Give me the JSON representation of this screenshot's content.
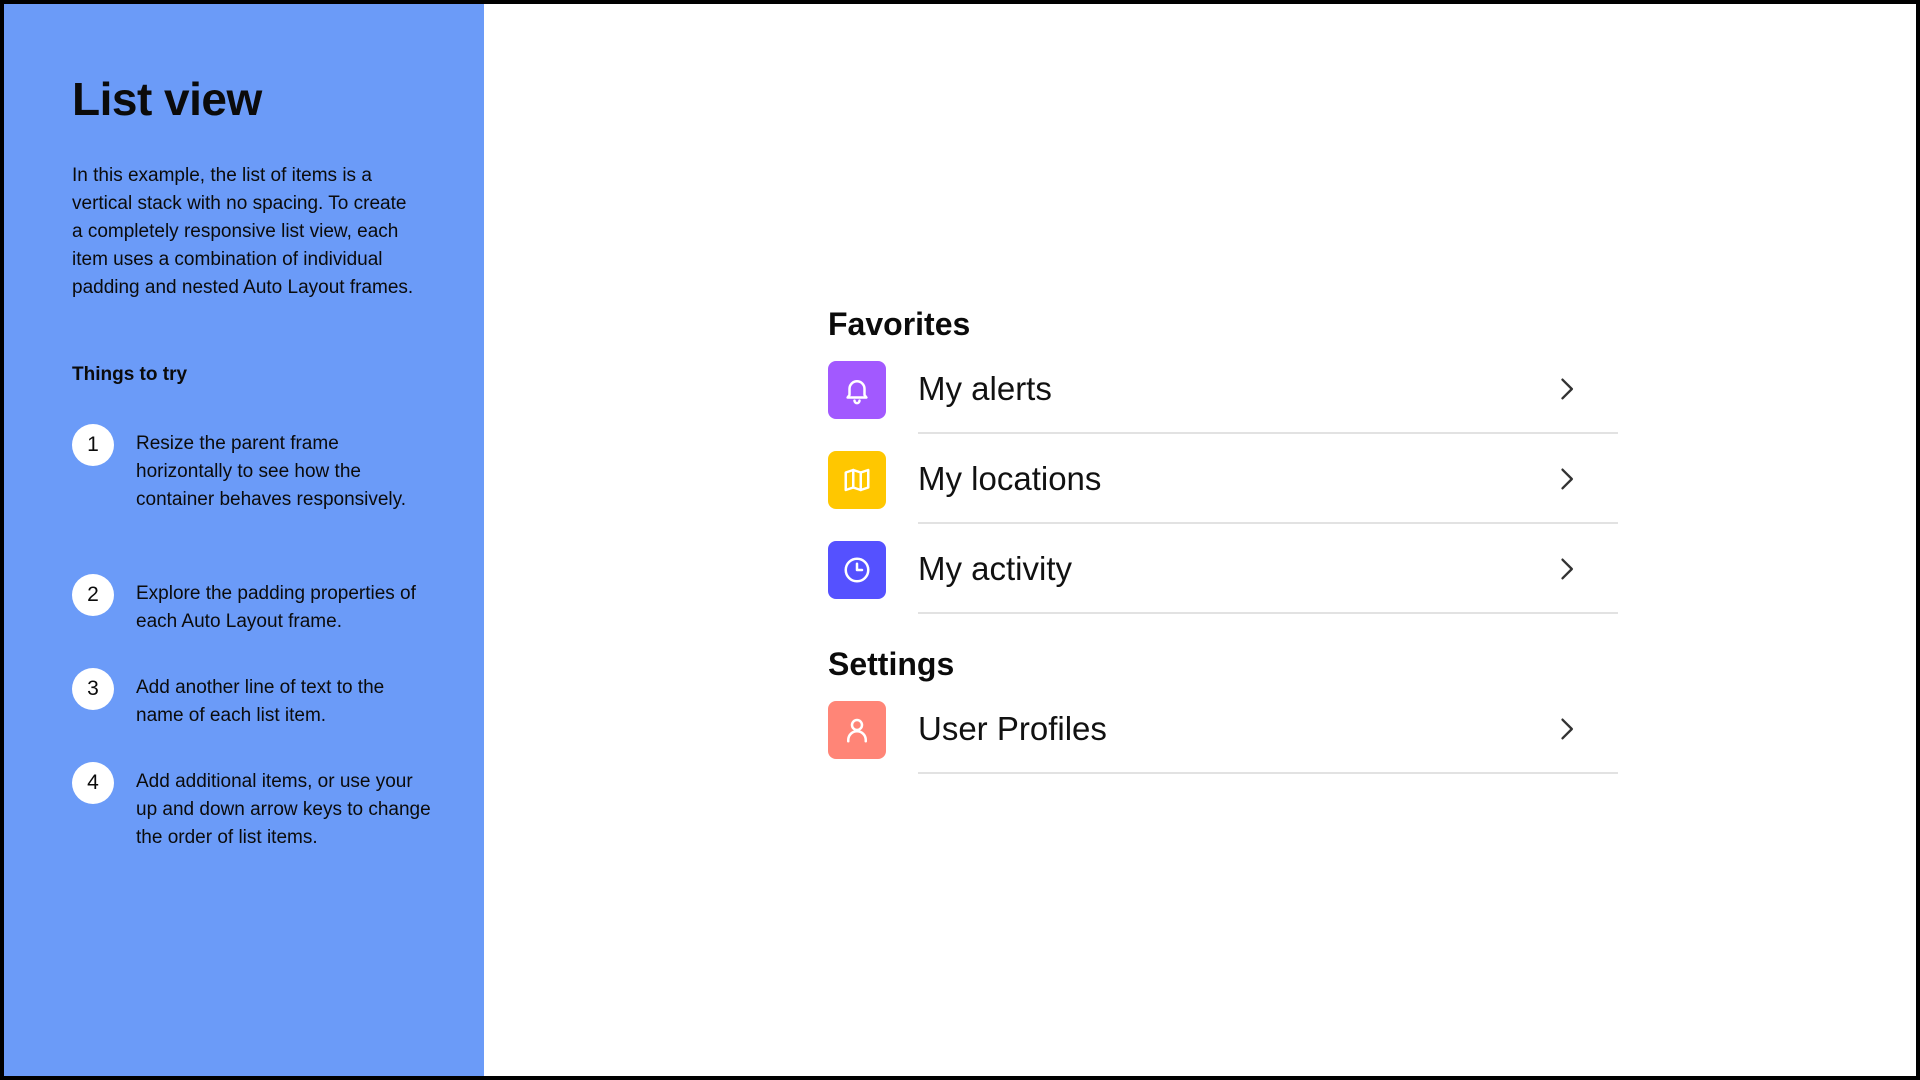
{
  "sidebar": {
    "title": "List view",
    "intro": "In this example, the list of items is a vertical stack with no spacing. To create a completely responsive list view, each item uses a combination of individual padding and nested Auto Layout frames.",
    "things_heading": "Things to try",
    "steps": [
      {
        "num": "1",
        "text": "Resize the parent frame horizontally to see how the container behaves responsively."
      },
      {
        "num": "2",
        "text": "Explore the padding properties of each Auto Layout frame."
      },
      {
        "num": "3",
        "text": "Add another line of text to the name of each list item."
      },
      {
        "num": "4",
        "text": "Add additional items, or use your up and down arrow keys to change the order of list items."
      }
    ],
    "background_color": "#6b9bf8"
  },
  "list": {
    "favorites": {
      "title": "Favorites",
      "items": [
        {
          "label": "My alerts",
          "icon": "bell-icon",
          "color": "#a259ff"
        },
        {
          "label": "My locations",
          "icon": "map-icon",
          "color": "#ffc700"
        },
        {
          "label": "My activity",
          "icon": "clock-icon",
          "color": "#5551ff"
        }
      ]
    },
    "settings": {
      "title": "Settings",
      "items": [
        {
          "label": "User Profiles",
          "icon": "user-icon",
          "color": "#ff8577"
        }
      ]
    }
  }
}
